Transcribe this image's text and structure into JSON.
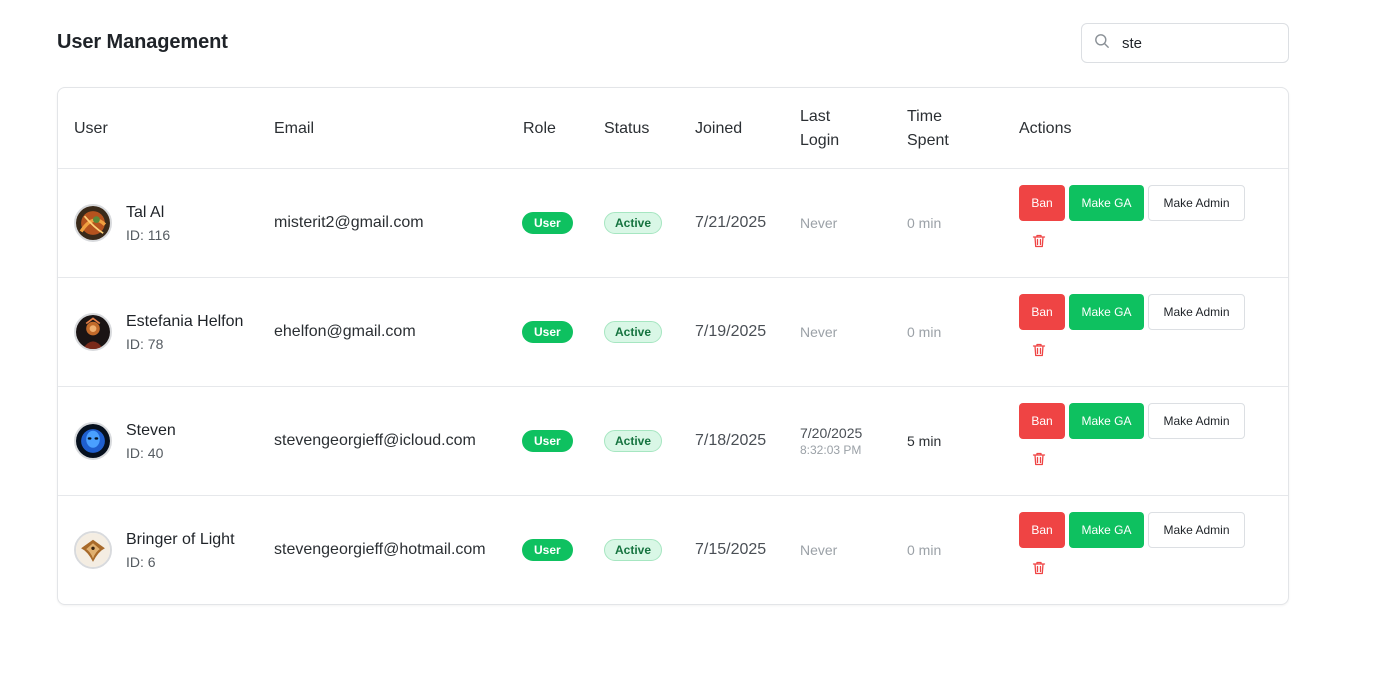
{
  "header": {
    "title": "User Management"
  },
  "search": {
    "value": "ste",
    "icon": "search-icon"
  },
  "table": {
    "columns": [
      "User",
      "Email",
      "Role",
      "Status",
      "Joined",
      "Last Login",
      "Time Spent",
      "Actions"
    ],
    "rows": [
      {
        "name": "Tal Al",
        "id": "ID: 116",
        "email": "misterit2@gmail.com",
        "role": "User",
        "status": "Active",
        "joined": "7/21/2025",
        "last_login": "Never",
        "last_login_time": "",
        "time_spent": "0 min"
      },
      {
        "name": "Estefania Helfon",
        "id": "ID: 78",
        "email": "ehelfon@gmail.com",
        "role": "User",
        "status": "Active",
        "joined": "7/19/2025",
        "last_login": "Never",
        "last_login_time": "",
        "time_spent": "0 min"
      },
      {
        "name": "Steven",
        "id": "ID: 40",
        "email": "stevengeorgieff@icloud.com",
        "role": "User",
        "status": "Active",
        "joined": "7/18/2025",
        "last_login": "7/20/2025",
        "last_login_time": "8:32:03 PM",
        "time_spent": "5 min"
      },
      {
        "name": "Bringer of Light",
        "id": "ID: 6",
        "email": "stevengeorgieff@hotmail.com",
        "role": "User",
        "status": "Active",
        "joined": "7/15/2025",
        "last_login": "Never",
        "last_login_time": "",
        "time_spent": "0 min"
      }
    ]
  },
  "actions": {
    "ban_label": "Ban",
    "make_ga_label": "Make GA",
    "make_admin_label": "Make Admin",
    "delete_icon": "trash-icon"
  },
  "colors": {
    "danger": "#ef4444",
    "success": "#0ec160",
    "status_bg": "#d9f7e6",
    "status_text": "#15733f"
  }
}
